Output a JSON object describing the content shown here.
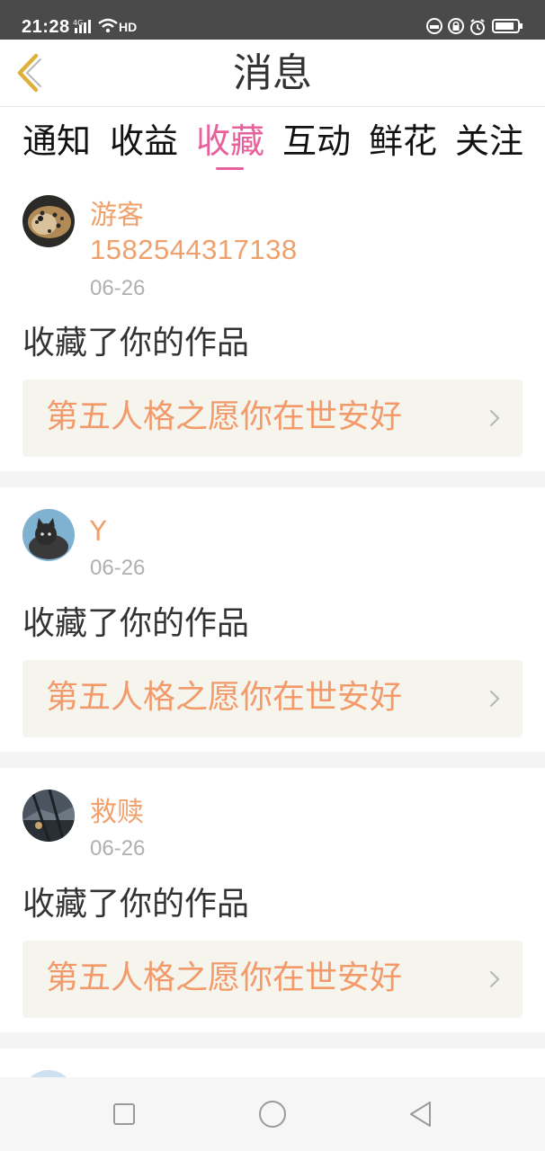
{
  "status_bar": {
    "time": "21:28",
    "network": "4G",
    "hd": "HD"
  },
  "header": {
    "title": "消息"
  },
  "tabs": [
    {
      "label": "通知"
    },
    {
      "label": "收益"
    },
    {
      "label": "收藏"
    },
    {
      "label": "互动"
    },
    {
      "label": "鲜花"
    },
    {
      "label": "关注"
    }
  ],
  "active_tab": "收藏",
  "messages": [
    {
      "user": "游客",
      "phone": "1582544317138",
      "date": "06-26",
      "action": "收藏了你的作品",
      "work": "第五人格之愿你在世安好"
    },
    {
      "user": "Y",
      "date": "06-26",
      "action": "收藏了你的作品",
      "work": "第五人格之愿你在世安好"
    },
    {
      "user": "救赎",
      "date": "06-26",
      "action": "收藏了你的作品",
      "work": "第五人格之愿你在世安好"
    }
  ],
  "colors": {
    "accent": "#e8619c",
    "name": "#f0a06a",
    "work_title": "#f39a6b",
    "work_bg": "#f5f5ee",
    "back_arrow": "#e0b13a"
  }
}
